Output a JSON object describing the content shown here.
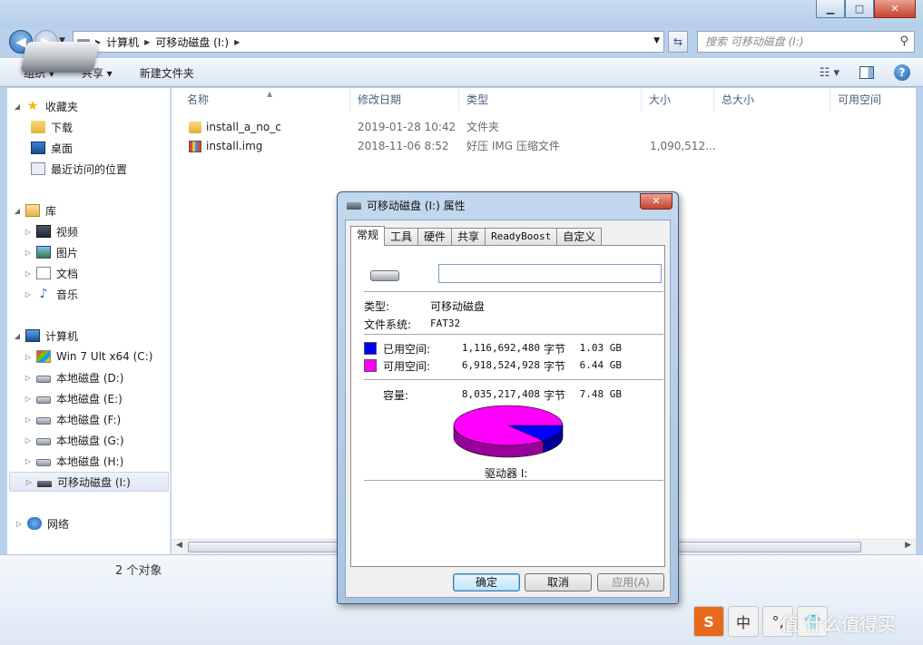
{
  "window": {
    "minimize": "▁",
    "maximize": "□",
    "close": "✕"
  },
  "address": {
    "crumbs": [
      "计算机",
      "可移动磁盘 (I:)"
    ],
    "search_placeholder": "搜索 可移动磁盘 (I:)"
  },
  "toolbar": {
    "organize": "组织 ▾",
    "share": "共享 ▾",
    "new_folder": "新建文件夹"
  },
  "nav": {
    "favorites": "收藏夹",
    "downloads": "下载",
    "desktop": "桌面",
    "recent": "最近访问的位置",
    "libraries": "库",
    "videos": "视频",
    "pictures": "图片",
    "documents": "文档",
    "music": "音乐",
    "computer": "计算机",
    "drive_c": "Win 7 Ult x64 (C:)",
    "drive_d": "本地磁盘 (D:)",
    "drive_e": "本地磁盘 (E:)",
    "drive_f": "本地磁盘 (F:)",
    "drive_g": "本地磁盘 (G:)",
    "drive_h": "本地磁盘 (H:)",
    "drive_i": "可移动磁盘 (I:)",
    "network": "网络"
  },
  "columns": {
    "name": "名称",
    "modified": "修改日期",
    "type": "类型",
    "size": "大小",
    "total": "总大小",
    "free": "可用空间"
  },
  "files": [
    {
      "name": "install_a_no_c",
      "modified": "2019-01-28 10:42",
      "type": "文件夹",
      "size": ""
    },
    {
      "name": "install.img",
      "modified": "2018-11-06 8:52",
      "type": "好压 IMG 压缩文件",
      "size": "1,090,512..."
    }
  ],
  "details": {
    "count": "2 个对象"
  },
  "tray": {
    "sogou": "S",
    "ime": "中",
    "punct": "°,",
    "shirt": "👕"
  },
  "watermark": "值 什么值得买",
  "dialog": {
    "title": "可移动磁盘 (I:) 属性",
    "close": "✕",
    "tabs": [
      "常规",
      "工具",
      "硬件",
      "共享",
      "ReadyBoost",
      "自定义"
    ],
    "name_value": "",
    "type_label": "类型:",
    "type_value": "可移动磁盘",
    "fs_label": "文件系统:",
    "fs_value": "FAT32",
    "used_label": "已用空间:",
    "used_bytes": "1,116,692,480",
    "used_gb": "1.03 GB",
    "free_label": "可用空间:",
    "free_bytes": "6,918,524,928",
    "free_gb": "6.44 GB",
    "cap_label": "容量:",
    "cap_bytes": "8,035,217,408",
    "cap_gb": "7.48 GB",
    "byte_unit": "字节",
    "drive_label": "驱动器 I:",
    "ok": "确定",
    "cancel": "取消",
    "apply": "应用(A)",
    "used_color": "#0000ff",
    "free_color": "#ff00ff"
  },
  "chart_data": {
    "type": "pie",
    "categories": [
      "已用空间",
      "可用空间"
    ],
    "values": [
      1116692480,
      6918524928
    ],
    "colors": [
      "#0000ff",
      "#ff00ff"
    ]
  }
}
